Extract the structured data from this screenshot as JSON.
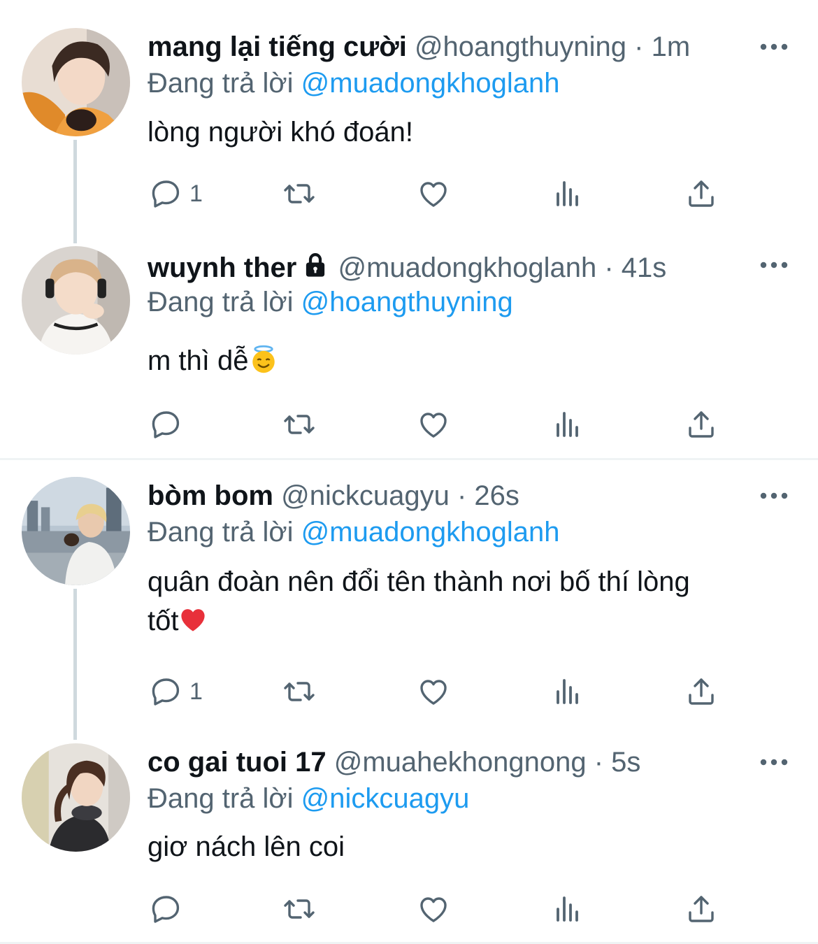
{
  "reply_prefix": "Đang trả lời",
  "tweets": [
    {
      "display_name": "mang lại tiếng cười",
      "handle": "@hoangthuyning",
      "time": "· 1m",
      "reply_to": "@muadongkhoglanh",
      "text": "lòng người khó đoán!",
      "reply_count": "1"
    },
    {
      "display_name": "wuynh ther",
      "handle": "@muadongkhoglanh",
      "time": "· 41s",
      "reply_to": "@hoangthuyning",
      "text": "m thì dễ",
      "reply_count": ""
    },
    {
      "display_name": "bòm bom",
      "handle": "@nickcuagyu",
      "time": "· 26s",
      "reply_to": "@muadongkhoglanh",
      "text_line1": "quân đoàn nên đổi tên thành nơi bố thí lòng",
      "text_line2": "tốt",
      "reply_count": "1"
    },
    {
      "display_name": "co gai tuoi 17",
      "handle": "@muahekhongnong",
      "time": "· 5s",
      "reply_to": "@nickcuagyu",
      "text": "giơ nách lên coi",
      "reply_count": ""
    }
  ],
  "icons": [
    "more-icon",
    "reply-icon",
    "retweet-icon",
    "like-icon",
    "views-icon",
    "share-icon",
    "lock-icon",
    "angel-emoji-icon",
    "red-heart-emoji-icon"
  ],
  "colors": {
    "link": "#1d9bf0",
    "muted": "#536471",
    "text": "#0f1419",
    "thread_line": "#cfd9de"
  }
}
